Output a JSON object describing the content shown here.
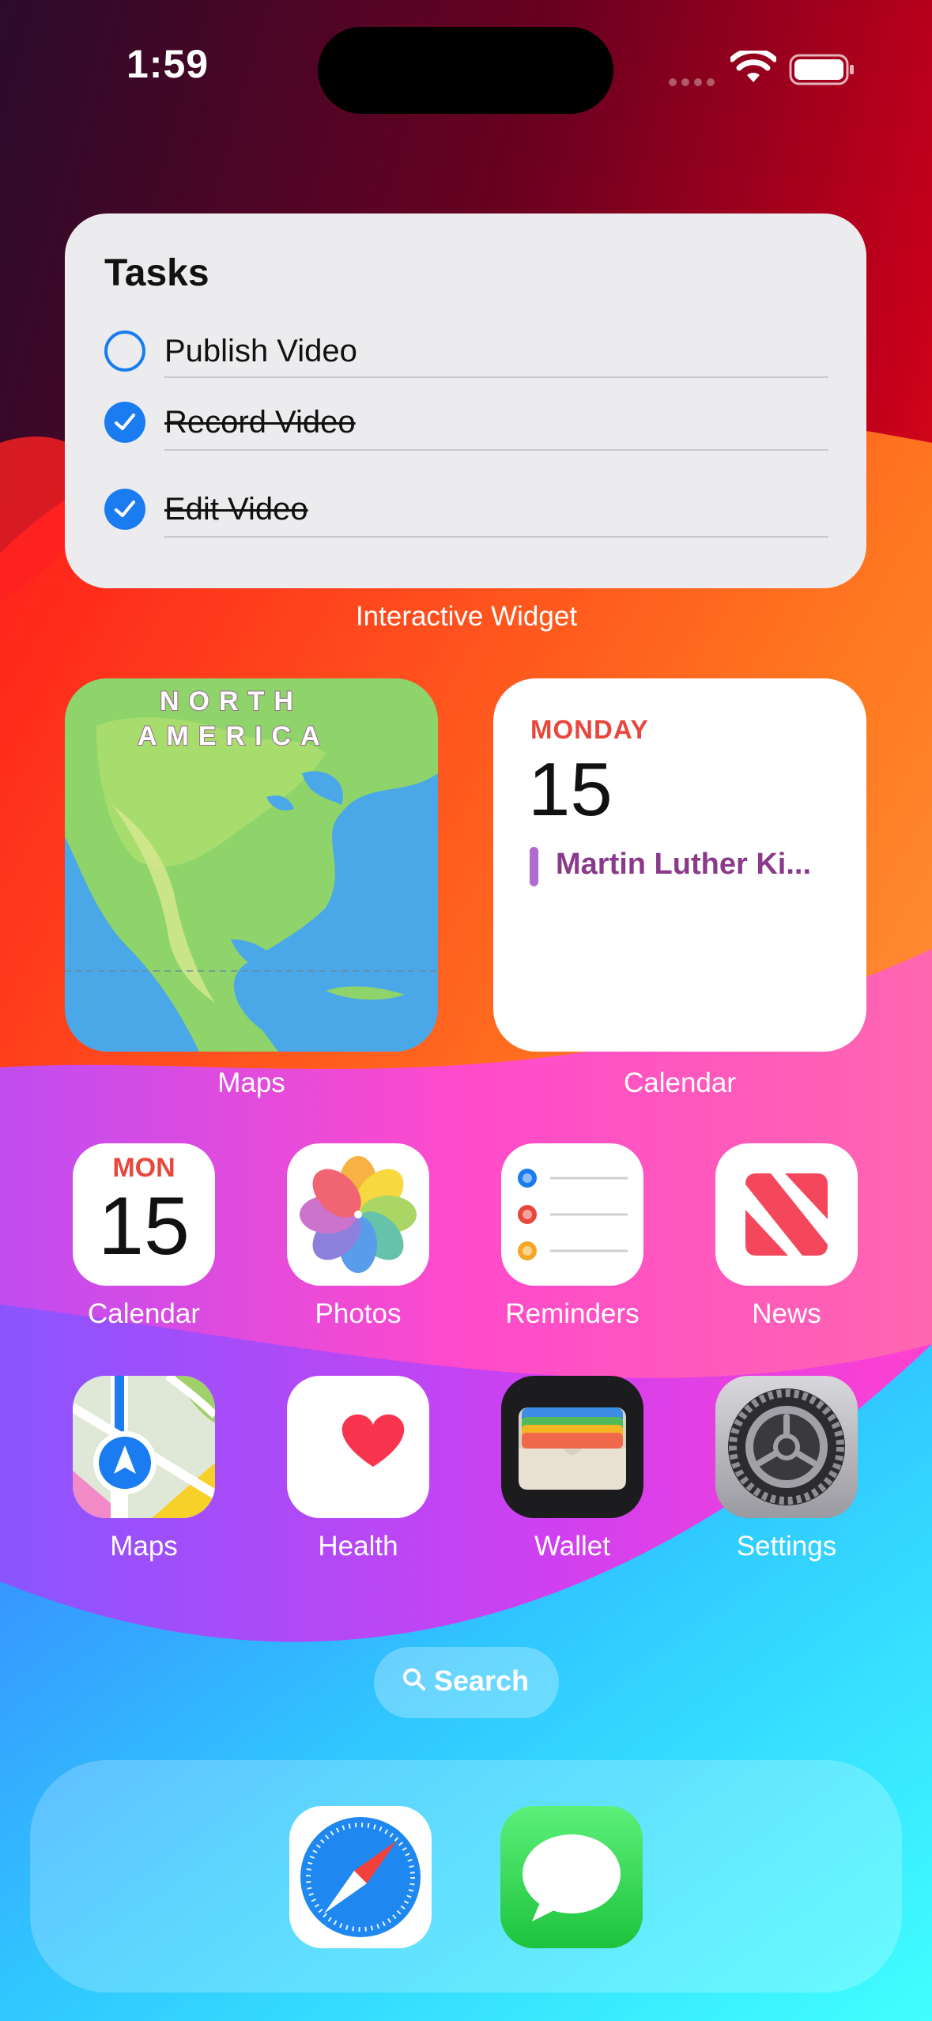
{
  "status_bar": {
    "time": "1:59"
  },
  "tasks_widget": {
    "title": "Tasks",
    "items": [
      {
        "label": "Publish Video",
        "done": false
      },
      {
        "label": "Record Video",
        "done": true
      },
      {
        "label": "Edit Video",
        "done": true
      }
    ],
    "caption": "Interactive Widget"
  },
  "maps_widget": {
    "map_label_line1": "NORTH",
    "map_label_line2": "AMERICA",
    "caption": "Maps"
  },
  "calendar_widget": {
    "weekday": "MONDAY",
    "date": "15",
    "event": "Martin Luther Ki...",
    "caption": "Calendar"
  },
  "apps": {
    "calendar": {
      "label": "Calendar",
      "icon_day": "MON",
      "icon_date": "15"
    },
    "photos": {
      "label": "Photos"
    },
    "reminders": {
      "label": "Reminders"
    },
    "news": {
      "label": "News"
    },
    "maps": {
      "label": "Maps"
    },
    "health": {
      "label": "Health"
    },
    "wallet": {
      "label": "Wallet"
    },
    "settings": {
      "label": "Settings"
    }
  },
  "search": {
    "label": "Search"
  },
  "dock": {
    "apps": [
      "safari-icon",
      "messages-icon"
    ]
  },
  "colors": {
    "accent_blue": "#1a7cf0",
    "calendar_red": "#e8473c",
    "event_purple": "#b06ad0"
  }
}
